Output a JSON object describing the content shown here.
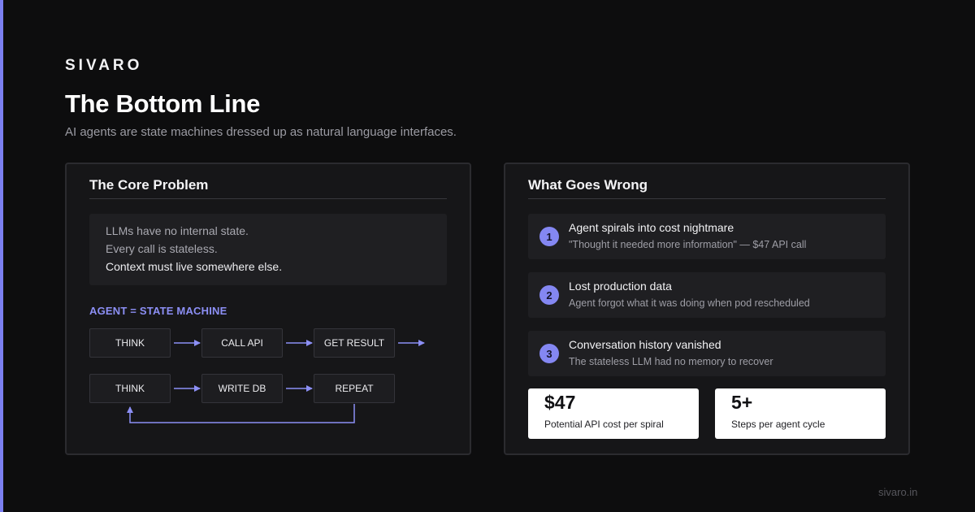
{
  "brand": "SIVARO",
  "title": "The Bottom Line",
  "subtitle": "AI agents are state machines dressed up as natural language interfaces.",
  "left_card": {
    "title": "The Core Problem",
    "problem_lines": [
      "LLMs have no internal state.",
      "Every call is stateless.",
      "Context must live somewhere else."
    ],
    "state_machine_label": "AGENT = STATE MACHINE",
    "flow_row_1": [
      "THINK",
      "CALL API",
      "GET RESULT"
    ],
    "flow_row_2": [
      "THINK",
      "WRITE DB",
      "REPEAT"
    ]
  },
  "right_card": {
    "title": "What Goes Wrong",
    "issues": [
      {
        "number": "1",
        "title": "Agent spirals into cost nightmare",
        "description": "\"Thought it needed more information\" — $47 API call"
      },
      {
        "number": "2",
        "title": "Lost production data",
        "description": "Agent forgot what it was doing when pod rescheduled"
      },
      {
        "number": "3",
        "title": "Conversation history vanished",
        "description": "The stateless LLM had no memory to recover"
      }
    ],
    "stats": [
      {
        "value": "$47",
        "label": "Potential API cost per spiral"
      },
      {
        "value": "5+",
        "label": "Steps per agent cycle"
      }
    ]
  },
  "footer": "sivaro.in",
  "colors": {
    "accent": "#7b7ff0",
    "background": "#0d0d0e",
    "card": "#161618",
    "badge": "#8487f2"
  }
}
